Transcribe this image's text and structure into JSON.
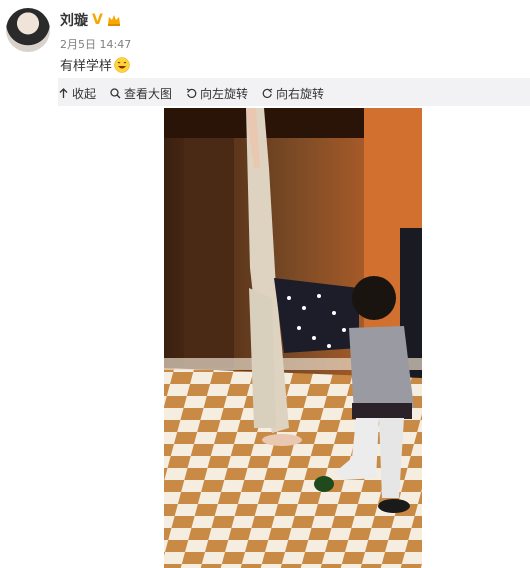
{
  "post": {
    "author_name": "刘璇",
    "verified_mark": "V",
    "timestamp": "2月5日 14:47",
    "text": "有样学样",
    "emoji_icon": "laughing-emoji-icon"
  },
  "toolbar": {
    "collapse_label": "收起",
    "view_large_label": "查看大图",
    "rotate_left_label": "向左旋转",
    "rotate_right_label": "向右旋转"
  },
  "colors": {
    "verified": "#f7a800",
    "panel": "#f2f2f5",
    "text": "#333333",
    "muted": "#808080"
  }
}
